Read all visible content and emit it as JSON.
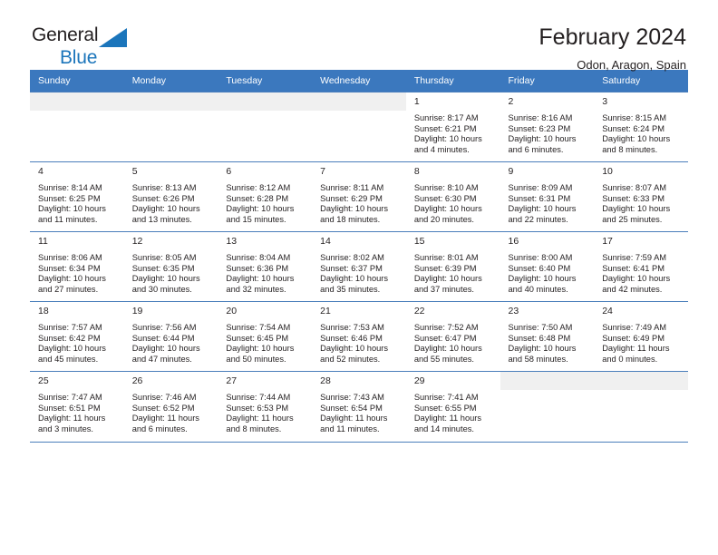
{
  "logo": {
    "line1": "General",
    "line2": "Blue",
    "triangle_icon": "blue-triangle-icon"
  },
  "header": {
    "title": "February 2024",
    "subtitle": "Odon, Aragon, Spain"
  },
  "colors": {
    "header_blue": "#3b78be",
    "grid_line": "#4a7ebb",
    "row_shade": "#f0f0f0",
    "logo_blue": "#1b75bb",
    "text": "#231f20"
  },
  "labels": {
    "sunrise": "Sunrise:",
    "sunset": "Sunset:",
    "daylight": "Daylight:"
  },
  "weekdays": [
    "Sunday",
    "Monday",
    "Tuesday",
    "Wednesday",
    "Thursday",
    "Friday",
    "Saturday"
  ],
  "weeks": [
    [
      {
        "day": "",
        "sunrise": "",
        "sunset": "",
        "daylight": "",
        "empty": true
      },
      {
        "day": "",
        "sunrise": "",
        "sunset": "",
        "daylight": "",
        "empty": true
      },
      {
        "day": "",
        "sunrise": "",
        "sunset": "",
        "daylight": "",
        "empty": true
      },
      {
        "day": "",
        "sunrise": "",
        "sunset": "",
        "daylight": "",
        "empty": true
      },
      {
        "day": "1",
        "sunrise": "Sunrise: 8:17 AM",
        "sunset": "Sunset: 6:21 PM",
        "daylight": "Daylight: 10 hours and 4 minutes."
      },
      {
        "day": "2",
        "sunrise": "Sunrise: 8:16 AM",
        "sunset": "Sunset: 6:23 PM",
        "daylight": "Daylight: 10 hours and 6 minutes."
      },
      {
        "day": "3",
        "sunrise": "Sunrise: 8:15 AM",
        "sunset": "Sunset: 6:24 PM",
        "daylight": "Daylight: 10 hours and 8 minutes."
      }
    ],
    [
      {
        "day": "4",
        "sunrise": "Sunrise: 8:14 AM",
        "sunset": "Sunset: 6:25 PM",
        "daylight": "Daylight: 10 hours and 11 minutes."
      },
      {
        "day": "5",
        "sunrise": "Sunrise: 8:13 AM",
        "sunset": "Sunset: 6:26 PM",
        "daylight": "Daylight: 10 hours and 13 minutes."
      },
      {
        "day": "6",
        "sunrise": "Sunrise: 8:12 AM",
        "sunset": "Sunset: 6:28 PM",
        "daylight": "Daylight: 10 hours and 15 minutes."
      },
      {
        "day": "7",
        "sunrise": "Sunrise: 8:11 AM",
        "sunset": "Sunset: 6:29 PM",
        "daylight": "Daylight: 10 hours and 18 minutes."
      },
      {
        "day": "8",
        "sunrise": "Sunrise: 8:10 AM",
        "sunset": "Sunset: 6:30 PM",
        "daylight": "Daylight: 10 hours and 20 minutes."
      },
      {
        "day": "9",
        "sunrise": "Sunrise: 8:09 AM",
        "sunset": "Sunset: 6:31 PM",
        "daylight": "Daylight: 10 hours and 22 minutes."
      },
      {
        "day": "10",
        "sunrise": "Sunrise: 8:07 AM",
        "sunset": "Sunset: 6:33 PM",
        "daylight": "Daylight: 10 hours and 25 minutes."
      }
    ],
    [
      {
        "day": "11",
        "sunrise": "Sunrise: 8:06 AM",
        "sunset": "Sunset: 6:34 PM",
        "daylight": "Daylight: 10 hours and 27 minutes."
      },
      {
        "day": "12",
        "sunrise": "Sunrise: 8:05 AM",
        "sunset": "Sunset: 6:35 PM",
        "daylight": "Daylight: 10 hours and 30 minutes."
      },
      {
        "day": "13",
        "sunrise": "Sunrise: 8:04 AM",
        "sunset": "Sunset: 6:36 PM",
        "daylight": "Daylight: 10 hours and 32 minutes."
      },
      {
        "day": "14",
        "sunrise": "Sunrise: 8:02 AM",
        "sunset": "Sunset: 6:37 PM",
        "daylight": "Daylight: 10 hours and 35 minutes."
      },
      {
        "day": "15",
        "sunrise": "Sunrise: 8:01 AM",
        "sunset": "Sunset: 6:39 PM",
        "daylight": "Daylight: 10 hours and 37 minutes."
      },
      {
        "day": "16",
        "sunrise": "Sunrise: 8:00 AM",
        "sunset": "Sunset: 6:40 PM",
        "daylight": "Daylight: 10 hours and 40 minutes."
      },
      {
        "day": "17",
        "sunrise": "Sunrise: 7:59 AM",
        "sunset": "Sunset: 6:41 PM",
        "daylight": "Daylight: 10 hours and 42 minutes."
      }
    ],
    [
      {
        "day": "18",
        "sunrise": "Sunrise: 7:57 AM",
        "sunset": "Sunset: 6:42 PM",
        "daylight": "Daylight: 10 hours and 45 minutes."
      },
      {
        "day": "19",
        "sunrise": "Sunrise: 7:56 AM",
        "sunset": "Sunset: 6:44 PM",
        "daylight": "Daylight: 10 hours and 47 minutes."
      },
      {
        "day": "20",
        "sunrise": "Sunrise: 7:54 AM",
        "sunset": "Sunset: 6:45 PM",
        "daylight": "Daylight: 10 hours and 50 minutes."
      },
      {
        "day": "21",
        "sunrise": "Sunrise: 7:53 AM",
        "sunset": "Sunset: 6:46 PM",
        "daylight": "Daylight: 10 hours and 52 minutes."
      },
      {
        "day": "22",
        "sunrise": "Sunrise: 7:52 AM",
        "sunset": "Sunset: 6:47 PM",
        "daylight": "Daylight: 10 hours and 55 minutes."
      },
      {
        "day": "23",
        "sunrise": "Sunrise: 7:50 AM",
        "sunset": "Sunset: 6:48 PM",
        "daylight": "Daylight: 10 hours and 58 minutes."
      },
      {
        "day": "24",
        "sunrise": "Sunrise: 7:49 AM",
        "sunset": "Sunset: 6:49 PM",
        "daylight": "Daylight: 11 hours and 0 minutes."
      }
    ],
    [
      {
        "day": "25",
        "sunrise": "Sunrise: 7:47 AM",
        "sunset": "Sunset: 6:51 PM",
        "daylight": "Daylight: 11 hours and 3 minutes."
      },
      {
        "day": "26",
        "sunrise": "Sunrise: 7:46 AM",
        "sunset": "Sunset: 6:52 PM",
        "daylight": "Daylight: 11 hours and 6 minutes."
      },
      {
        "day": "27",
        "sunrise": "Sunrise: 7:44 AM",
        "sunset": "Sunset: 6:53 PM",
        "daylight": "Daylight: 11 hours and 8 minutes."
      },
      {
        "day": "28",
        "sunrise": "Sunrise: 7:43 AM",
        "sunset": "Sunset: 6:54 PM",
        "daylight": "Daylight: 11 hours and 11 minutes."
      },
      {
        "day": "29",
        "sunrise": "Sunrise: 7:41 AM",
        "sunset": "Sunset: 6:55 PM",
        "daylight": "Daylight: 11 hours and 14 minutes."
      },
      {
        "day": "",
        "sunrise": "",
        "sunset": "",
        "daylight": "",
        "empty": true
      },
      {
        "day": "",
        "sunrise": "",
        "sunset": "",
        "daylight": "",
        "empty": true
      }
    ]
  ]
}
